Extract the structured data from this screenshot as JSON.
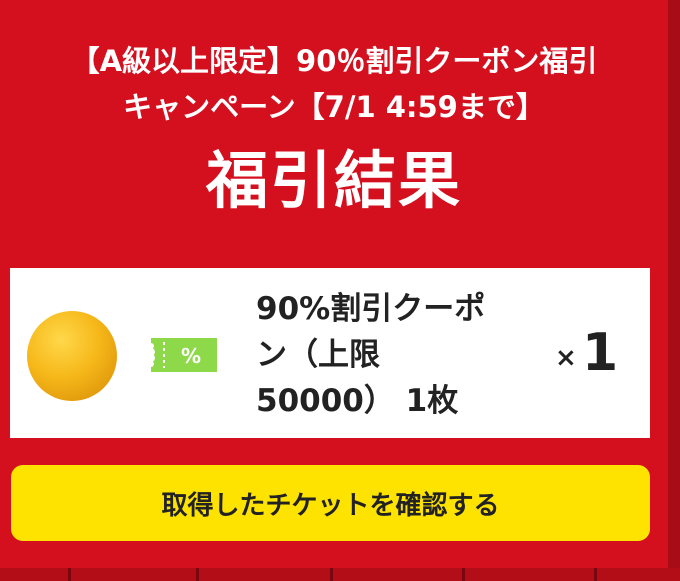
{
  "campaign": {
    "title_line1": "【A級以上限定】90％割引クーポン福引",
    "title_line2": "キャンペーン【7/1 4:59まで】"
  },
  "result_title": "福引結果",
  "prize": {
    "name_line1": "90%割引クーポ",
    "name_line2": "ン（上限",
    "name_line3": "50000） 1枚",
    "coupon_icon_symbol": "%",
    "quantity_prefix": "×",
    "quantity": "1"
  },
  "confirm_button_label": "取得したチケットを確認する",
  "colors": {
    "background": "#d40f1e",
    "button": "#ffe300",
    "coupon_icon": "#8ed94a",
    "ball": "#f6b81a"
  }
}
